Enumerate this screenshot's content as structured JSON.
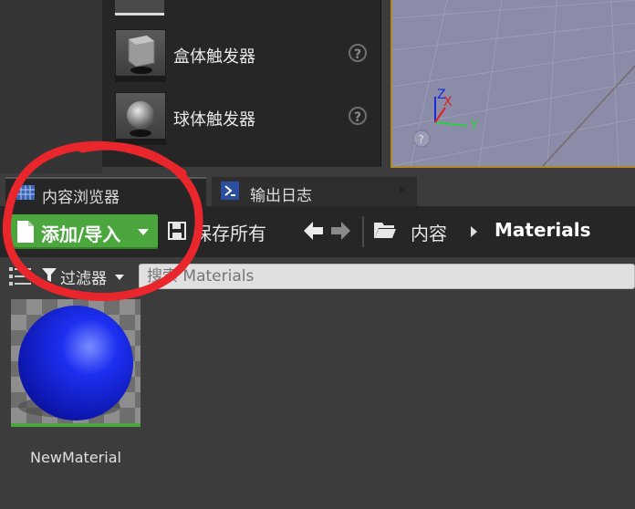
{
  "placement_items": [
    {
      "label": "盒体触发器",
      "help": "?"
    },
    {
      "label": "球体触发器",
      "help": "?"
    }
  ],
  "viewport": {
    "axis_z": "Z",
    "axis_x": "X",
    "axis_y": "Y"
  },
  "tabs": [
    {
      "label": "内容浏览器"
    },
    {
      "label": "输出日志"
    }
  ],
  "toolbar": {
    "add_import_label": "添加/导入",
    "save_all_label": "保存所有",
    "breadcrumb": [
      "内容",
      "Materials"
    ]
  },
  "filter": {
    "label": "过滤器",
    "search_placeholder": "搜索 Materials"
  },
  "assets": [
    {
      "name": "NewMaterial",
      "type_color": "#4aa63d"
    }
  ],
  "colors": {
    "accent_green": "#4aa63d",
    "annotation_red": "#e8262b",
    "viewport_border": "#b08a2a"
  },
  "icons": {
    "content_tab": "grid-icon",
    "output_tab": "terminal-icon",
    "add": "document-icon",
    "save": "floppy-disk-icon",
    "back": "arrow-left-icon",
    "forward": "arrow-right-icon",
    "folder": "folder-icon",
    "filter": "funnel-icon"
  }
}
